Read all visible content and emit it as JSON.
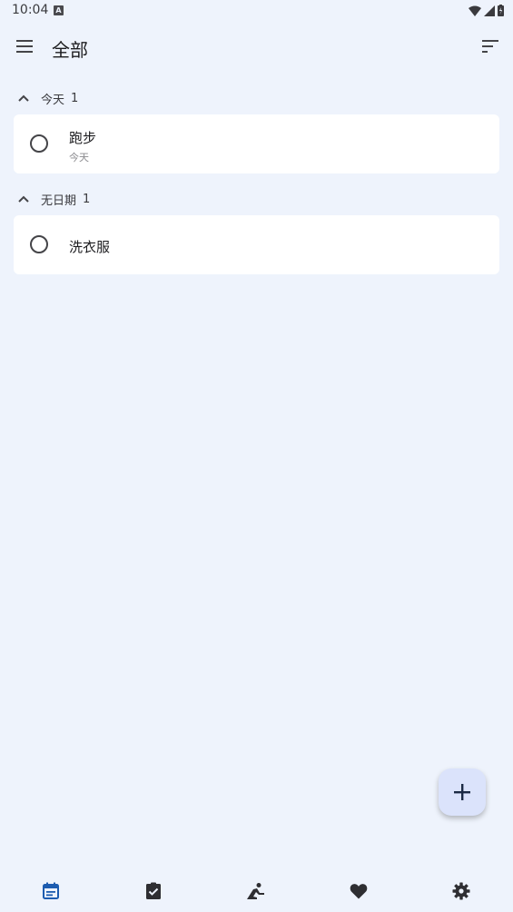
{
  "status_bar": {
    "time": "10:04",
    "notification_icon": "a-icon"
  },
  "app_bar": {
    "title": "全部"
  },
  "sections": [
    {
      "label": "今天",
      "count": "1",
      "tasks": [
        {
          "title": "跑步",
          "subtitle": "今天"
        }
      ]
    },
    {
      "label": "无日期",
      "count": "1",
      "tasks": [
        {
          "title": "洗衣服"
        }
      ]
    }
  ],
  "bottom_nav": {
    "items": [
      {
        "icon": "calendar-icon",
        "active": true
      },
      {
        "icon": "checklist-icon",
        "active": false
      },
      {
        "icon": "meditation-icon",
        "active": false
      },
      {
        "icon": "heart-icon",
        "active": false
      },
      {
        "icon": "gear-icon",
        "active": false
      }
    ]
  },
  "colors": {
    "background": "#eef3fc",
    "card": "#ffffff",
    "accent": "#1d5cb0",
    "fab": "#dbe3fb",
    "icon": "#444448"
  }
}
